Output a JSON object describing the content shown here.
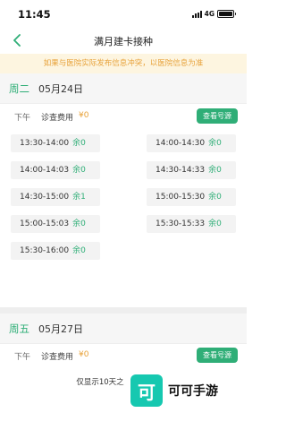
{
  "status_bar": {
    "time": "11:45",
    "network": "4G"
  },
  "nav": {
    "title": "满月建卡接种",
    "back_icon": "chevron-left-icon"
  },
  "notice": "如果与医院实际发布信息冲突，以医院信息为准",
  "days": [
    {
      "weekday": "周二",
      "date": "05月24日",
      "session": {
        "label": "下午",
        "fee_label": "诊查费用",
        "fee_value": "¥0",
        "button": "查看号源"
      },
      "slots": [
        {
          "time": "13:30-14:00",
          "remain": "余0"
        },
        {
          "time": "14:00-14:30",
          "remain": "余0"
        },
        {
          "time": "14:00-14:03",
          "remain": "余0"
        },
        {
          "time": "14:30-14:33",
          "remain": "余0"
        },
        {
          "time": "14:30-15:00",
          "remain": "余1"
        },
        {
          "time": "15:00-15:30",
          "remain": "余0"
        },
        {
          "time": "15:00-15:03",
          "remain": "余0"
        },
        {
          "time": "15:30-15:33",
          "remain": "余0"
        },
        {
          "time": "15:30-16:00",
          "remain": "余0"
        }
      ]
    },
    {
      "weekday": "周五",
      "date": "05月27日",
      "session": {
        "label": "下午",
        "fee_label": "诊查费用",
        "fee_value": "¥0",
        "button": "查看号源"
      }
    }
  ],
  "footer_note": "仅显示10天之",
  "watermark": {
    "logo_char": "可",
    "text": "可可手游"
  },
  "colors": {
    "accent": "#2fae77",
    "notice_bg": "#fdf5e0",
    "notice_text": "#e8a23a",
    "watermark": "#16c8b0"
  }
}
